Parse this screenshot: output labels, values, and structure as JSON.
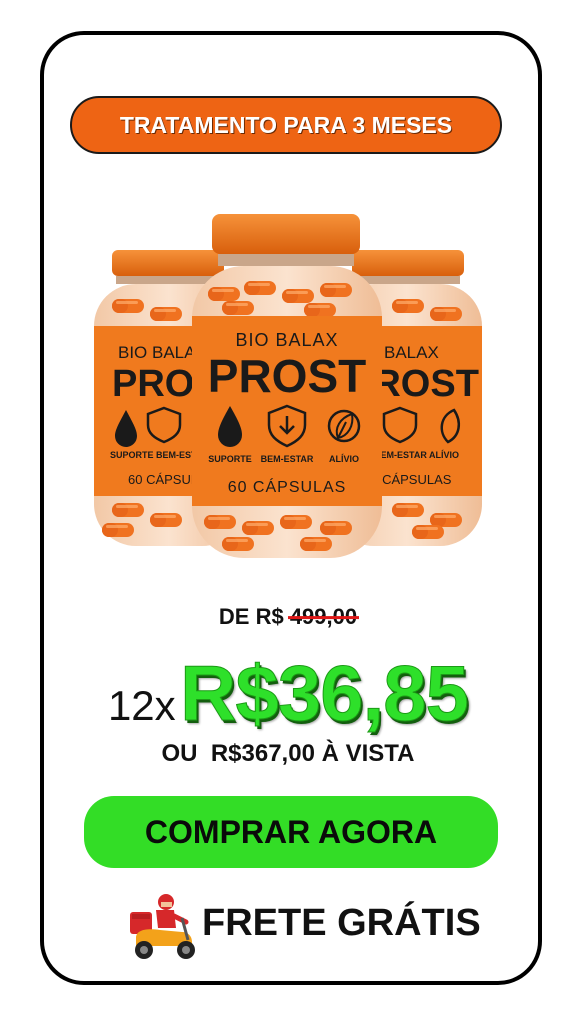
{
  "offer": {
    "badge": "TRATAMENTO PARA 3 MESES",
    "product": {
      "brand": "BIO BALAX",
      "name": "PROST",
      "icon_labels": [
        "SUPORTE",
        "BEM-ESTAR",
        "ALÍVIO"
      ],
      "capsules": "60 CÁPSULAS",
      "jar_count": 3
    },
    "old_price_prefix": "DE R$",
    "old_price_value": "499,00",
    "installments": "12x",
    "installment_price": "R$36,85",
    "cash_price": "OU  R$367,00 À VISTA",
    "cta": "COMPRAR AGORA",
    "shipping": "FRETE GRÁTIS"
  },
  "colors": {
    "badge_bg": "#ee6414",
    "jar_orange": "#f07a1e",
    "price_green": "#2ee02a",
    "cta_green": "#33dd26",
    "strike_red": "#e01818"
  },
  "icons": [
    "drop-icon",
    "shield-check-icon",
    "leaf-icon",
    "delivery-scooter-icon"
  ]
}
